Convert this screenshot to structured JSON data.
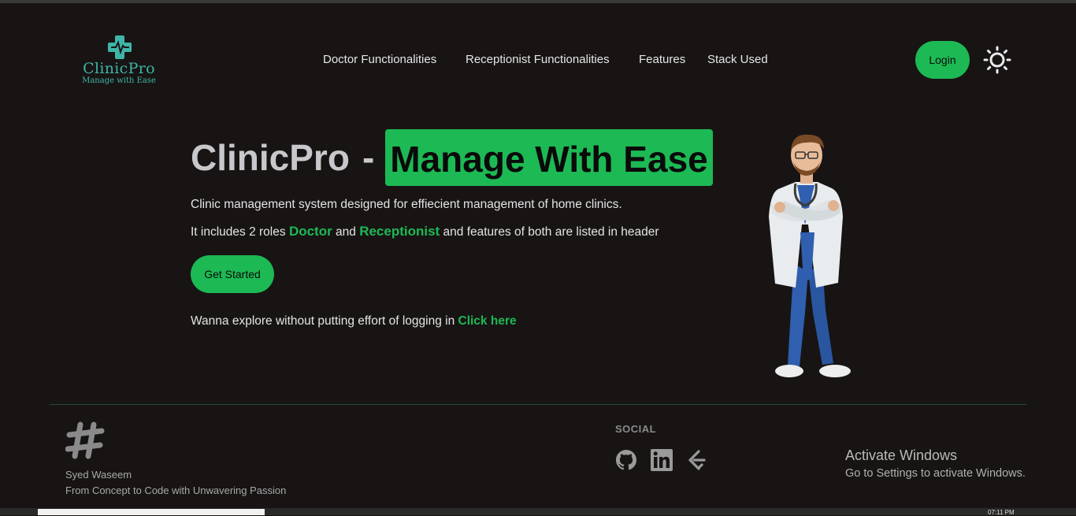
{
  "brand": {
    "name": "ClinicPro",
    "tagline": "Manage with Ease"
  },
  "nav": {
    "items": [
      "Doctor Functionalities",
      "Receptionist Functionalities",
      "Features",
      "Stack Used"
    ]
  },
  "header": {
    "login_label": "Login"
  },
  "hero": {
    "title": "ClinicPro",
    "dash": "-",
    "highlight": "Manage With Ease",
    "desc1": "Clinic management system designed for effiecient management of home clinics.",
    "desc2_pre": "It includes 2 roles ",
    "role1": "Doctor",
    "desc2_mid": " and ",
    "role2": "Receptionist",
    "desc2_post": " and features of both are listed in header",
    "cta_label": "Get Started",
    "explore_text": "Wanna explore without putting effort of logging in ",
    "explore_link": "Click here"
  },
  "footer": {
    "author": "Syed Waseem",
    "motto": "From Concept to Code with Unwavering Passion",
    "social_title": "SOCIAL",
    "social_icons": [
      "github-icon",
      "linkedin-icon",
      "leetcode-icon"
    ]
  },
  "watermark": {
    "title": "Activate Windows",
    "subtitle": "Go to Settings to activate Windows."
  },
  "taskbar": {
    "clock": "07:11 PM"
  },
  "colors": {
    "accent": "#1db954",
    "background": "#181414",
    "logo": "#3fb5a6"
  }
}
